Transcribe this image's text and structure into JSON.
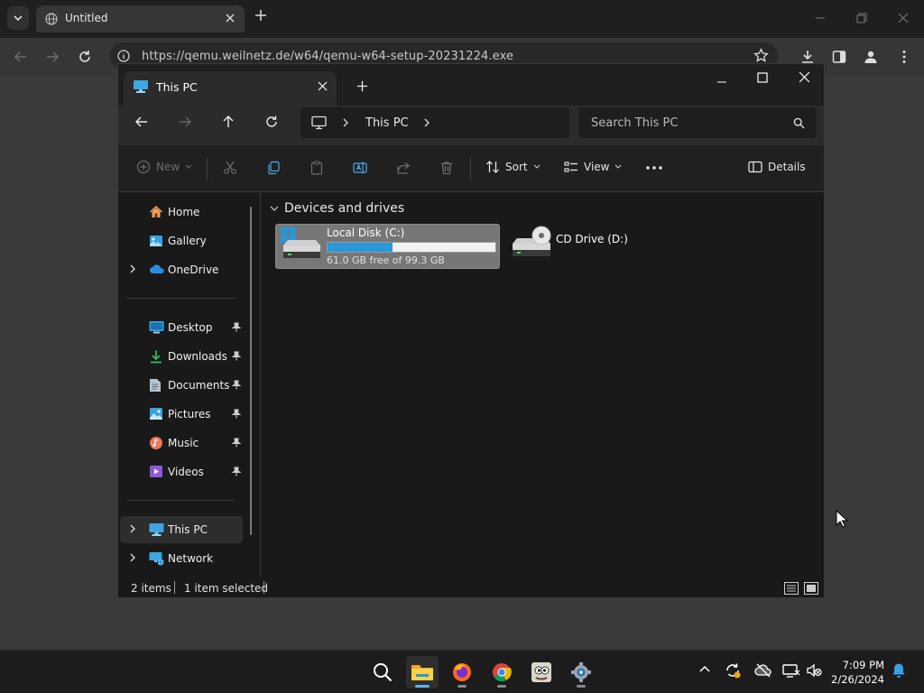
{
  "browser": {
    "tab_title": "Untitled",
    "url": "https://qemu.weilnetz.de/w64/qemu-w64-setup-20231224.exe"
  },
  "explorer": {
    "tab_title": "This PC",
    "breadcrumb": "This PC",
    "search_placeholder": "Search This PC",
    "commands": {
      "new": "New",
      "sort": "Sort",
      "view": "View",
      "details": "Details"
    },
    "nav": {
      "home": "Home",
      "gallery": "Gallery",
      "onedrive": "OneDrive",
      "desktop": "Desktop",
      "downloads": "Downloads",
      "documents": "Documents",
      "pictures": "Pictures",
      "music": "Music",
      "videos": "Videos",
      "this_pc": "This PC",
      "network": "Network"
    },
    "group_header": "Devices and drives",
    "drives": [
      {
        "name": "Local Disk (C:)",
        "free_text": "61.0 GB free of 99.3 GB",
        "used_fraction": 0.386
      },
      {
        "name": "CD Drive (D:)"
      }
    ],
    "status": {
      "items": "2 items",
      "selected": "1 item selected"
    }
  },
  "taskbar": {
    "time": "7:09 PM",
    "date": "2/26/2024"
  },
  "colors": {
    "accent": "#2a97d8",
    "active_indicator": "#5fb2f2"
  }
}
